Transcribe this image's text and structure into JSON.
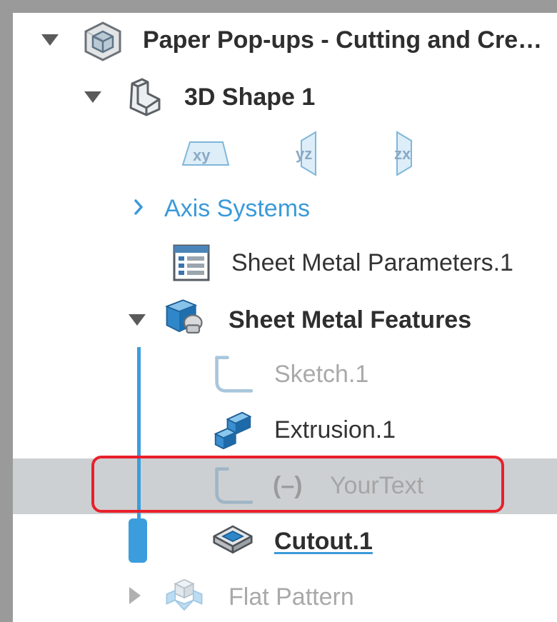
{
  "tree": {
    "root": {
      "label": "Paper Pop-ups - Cutting and Cre…",
      "icon": "product-icon",
      "expanded": true
    },
    "shape": {
      "label": "3D Shape 1",
      "icon": "3d-shape-icon",
      "expanded": true
    },
    "planes": [
      {
        "label": "xy",
        "icon": "xy-plane-icon"
      },
      {
        "label": "yz",
        "icon": "yz-plane-icon"
      },
      {
        "label": "zx",
        "icon": "zx-plane-icon"
      }
    ],
    "axis_systems": {
      "label": "Axis Systems",
      "expanded": false
    },
    "sheet_metal_parameters": {
      "label": "Sheet Metal Parameters.1",
      "icon": "parameters-table-icon"
    },
    "sheet_metal_features": {
      "label": "Sheet Metal Features",
      "icon": "sheet-metal-features-icon",
      "expanded": true
    },
    "features": [
      {
        "label": "Sketch.1",
        "icon": "sketch-icon",
        "state": "dimmed"
      },
      {
        "label": "Extrusion.1",
        "icon": "extrusion-icon",
        "state": "normal"
      },
      {
        "label": "YourText",
        "prefix": "(–)",
        "icon": "sketch-icon",
        "state": "selected-deactivated"
      },
      {
        "label": "Cutout.1",
        "icon": "cutout-icon",
        "state": "current"
      }
    ],
    "flat_pattern": {
      "label": "Flat Pattern",
      "icon": "flat-pattern-icon",
      "expanded": false
    }
  },
  "colors": {
    "accent": "#3b9ddc",
    "highlight_border": "#e8202a",
    "selected_row": "#cdd0d2",
    "dim_text": "#a9a9a9"
  }
}
